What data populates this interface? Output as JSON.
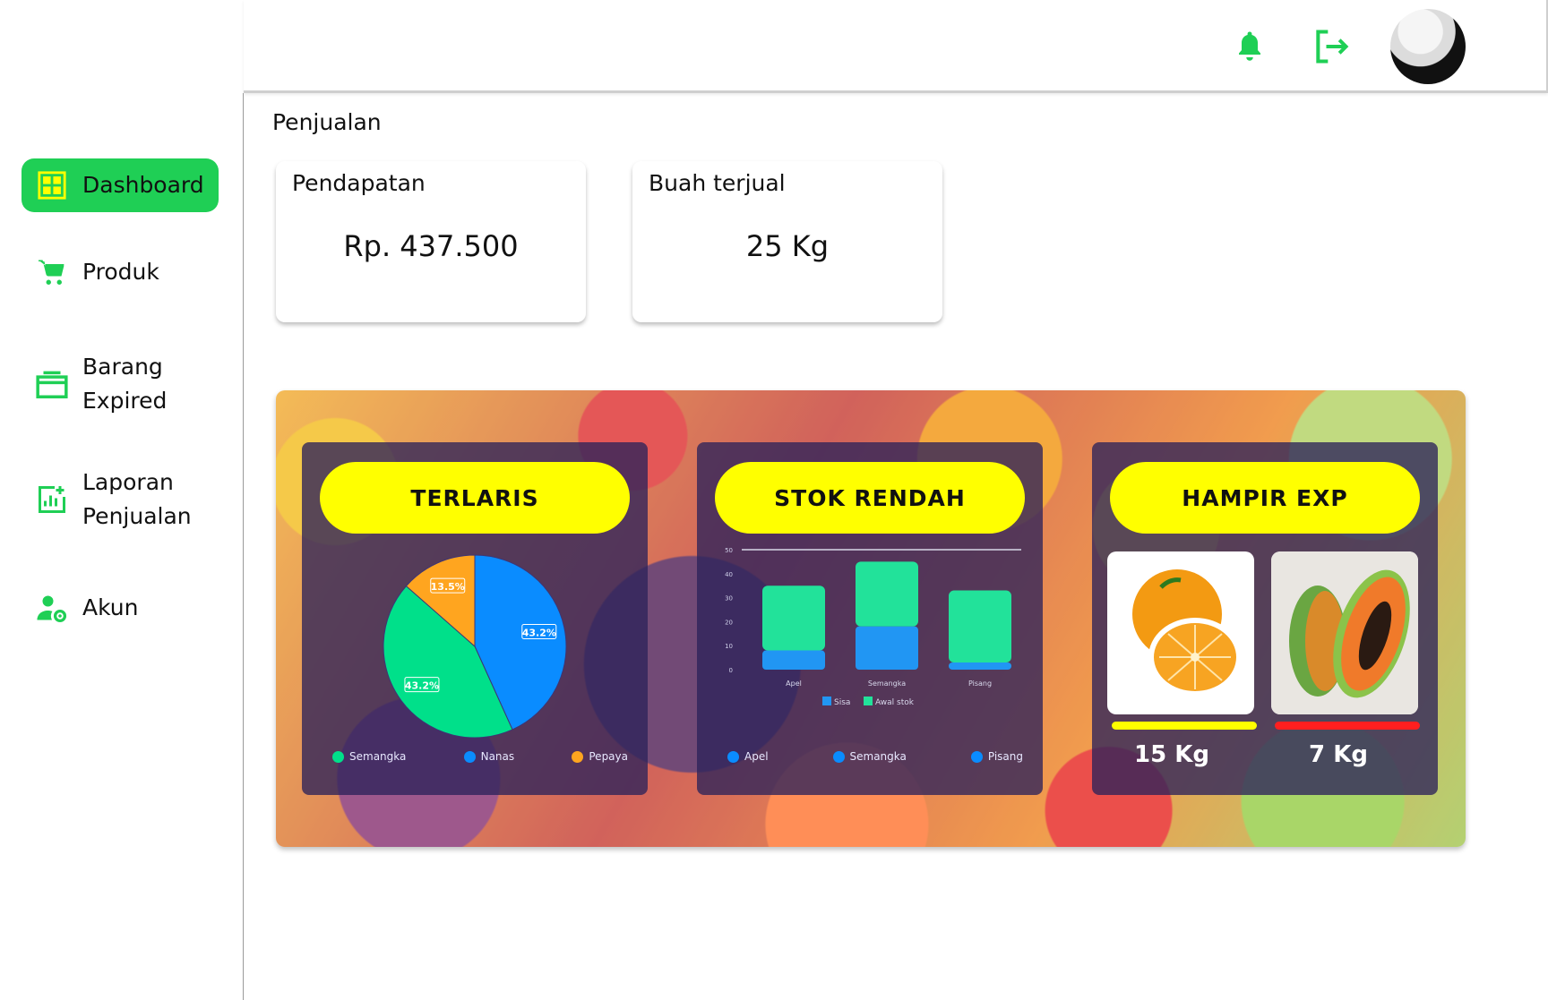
{
  "header": {
    "icons": [
      "bell-icon",
      "logout-icon",
      "avatar"
    ],
    "accent": "#1fcf55"
  },
  "sidebar": {
    "items": [
      {
        "label": "Dashboard",
        "icon": "dashboard-grid-icon",
        "active": true
      },
      {
        "label": "Produk",
        "icon": "cart-icon",
        "active": false
      },
      {
        "label": "Barang Expired",
        "icon": "box-icon",
        "active": false
      },
      {
        "label": "Laporan Penjualan",
        "icon": "report-chart-icon",
        "active": false
      },
      {
        "label": "Akun",
        "icon": "user-gear-icon",
        "active": false
      }
    ]
  },
  "main": {
    "title": "Penjualan",
    "stats": [
      {
        "label": "Pendapatan",
        "value": "Rp. 437.500"
      },
      {
        "label": "Buah terjual",
        "value": "25 Kg"
      }
    ]
  },
  "panels": {
    "terlaris": {
      "title": "TERLARIS",
      "legend": [
        {
          "name": "Semangka",
          "color": "#00e08a"
        },
        {
          "name": "Nanas",
          "color": "#0a8cff"
        },
        {
          "name": "Pepaya",
          "color": "#ffa51f"
        }
      ]
    },
    "stok": {
      "title": "STOK RENDAH",
      "legend": [
        {
          "name": "Apel",
          "color": "#0a8cff"
        },
        {
          "name": "Semangka",
          "color": "#0a8cff"
        },
        {
          "name": "Pisang",
          "color": "#0a8cff"
        }
      ]
    },
    "expired": {
      "title": "HAMPIR EXP",
      "items": [
        {
          "label": "15 Kg",
          "fruit": "orange",
          "bar_color": "#ffff00"
        },
        {
          "label": "7 Kg",
          "fruit": "papaya",
          "bar_color": "#ff1f1f"
        }
      ]
    }
  },
  "chart_data": [
    {
      "type": "pie",
      "title": "TERLARIS",
      "slices": [
        {
          "name": "Nanas",
          "value": 43.2,
          "label": "43.2%",
          "color": "#0a8cff"
        },
        {
          "name": "Semangka",
          "value": 43.2,
          "label": "43.2%",
          "color": "#00e08a"
        },
        {
          "name": "Pepaya",
          "value": 13.5,
          "label": "13.5%",
          "color": "#ffa51f"
        }
      ]
    },
    {
      "type": "bar",
      "title": "STOK RENDAH",
      "stacked": true,
      "categories": [
        "Apel",
        "Semangka",
        "Pisang"
      ],
      "series": [
        {
          "name": "Sisa",
          "values": [
            8,
            18,
            3
          ],
          "color": "#2196f3"
        },
        {
          "name": "Awal stok",
          "values": [
            35,
            45,
            33
          ],
          "color": "#22e29a"
        }
      ],
      "ylim": [
        0,
        50
      ]
    }
  ]
}
